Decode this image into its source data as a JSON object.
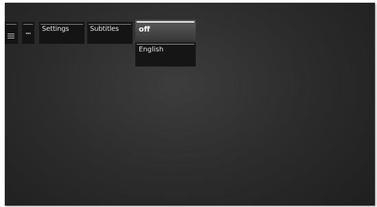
{
  "menu": {
    "columns": [
      {
        "icon": "film-icon"
      },
      {
        "icon": "ellipsis-icon",
        "text": "···"
      },
      {
        "label": "Settings"
      },
      {
        "label": "Subtitles"
      }
    ],
    "options": [
      {
        "label": "off",
        "selected": true
      },
      {
        "label": "English",
        "selected": false
      }
    ]
  },
  "colors": {
    "background": "#2c2c2c",
    "panel": "#141414",
    "highlight": "#4a4a4a",
    "text": "#e6e6e6"
  }
}
